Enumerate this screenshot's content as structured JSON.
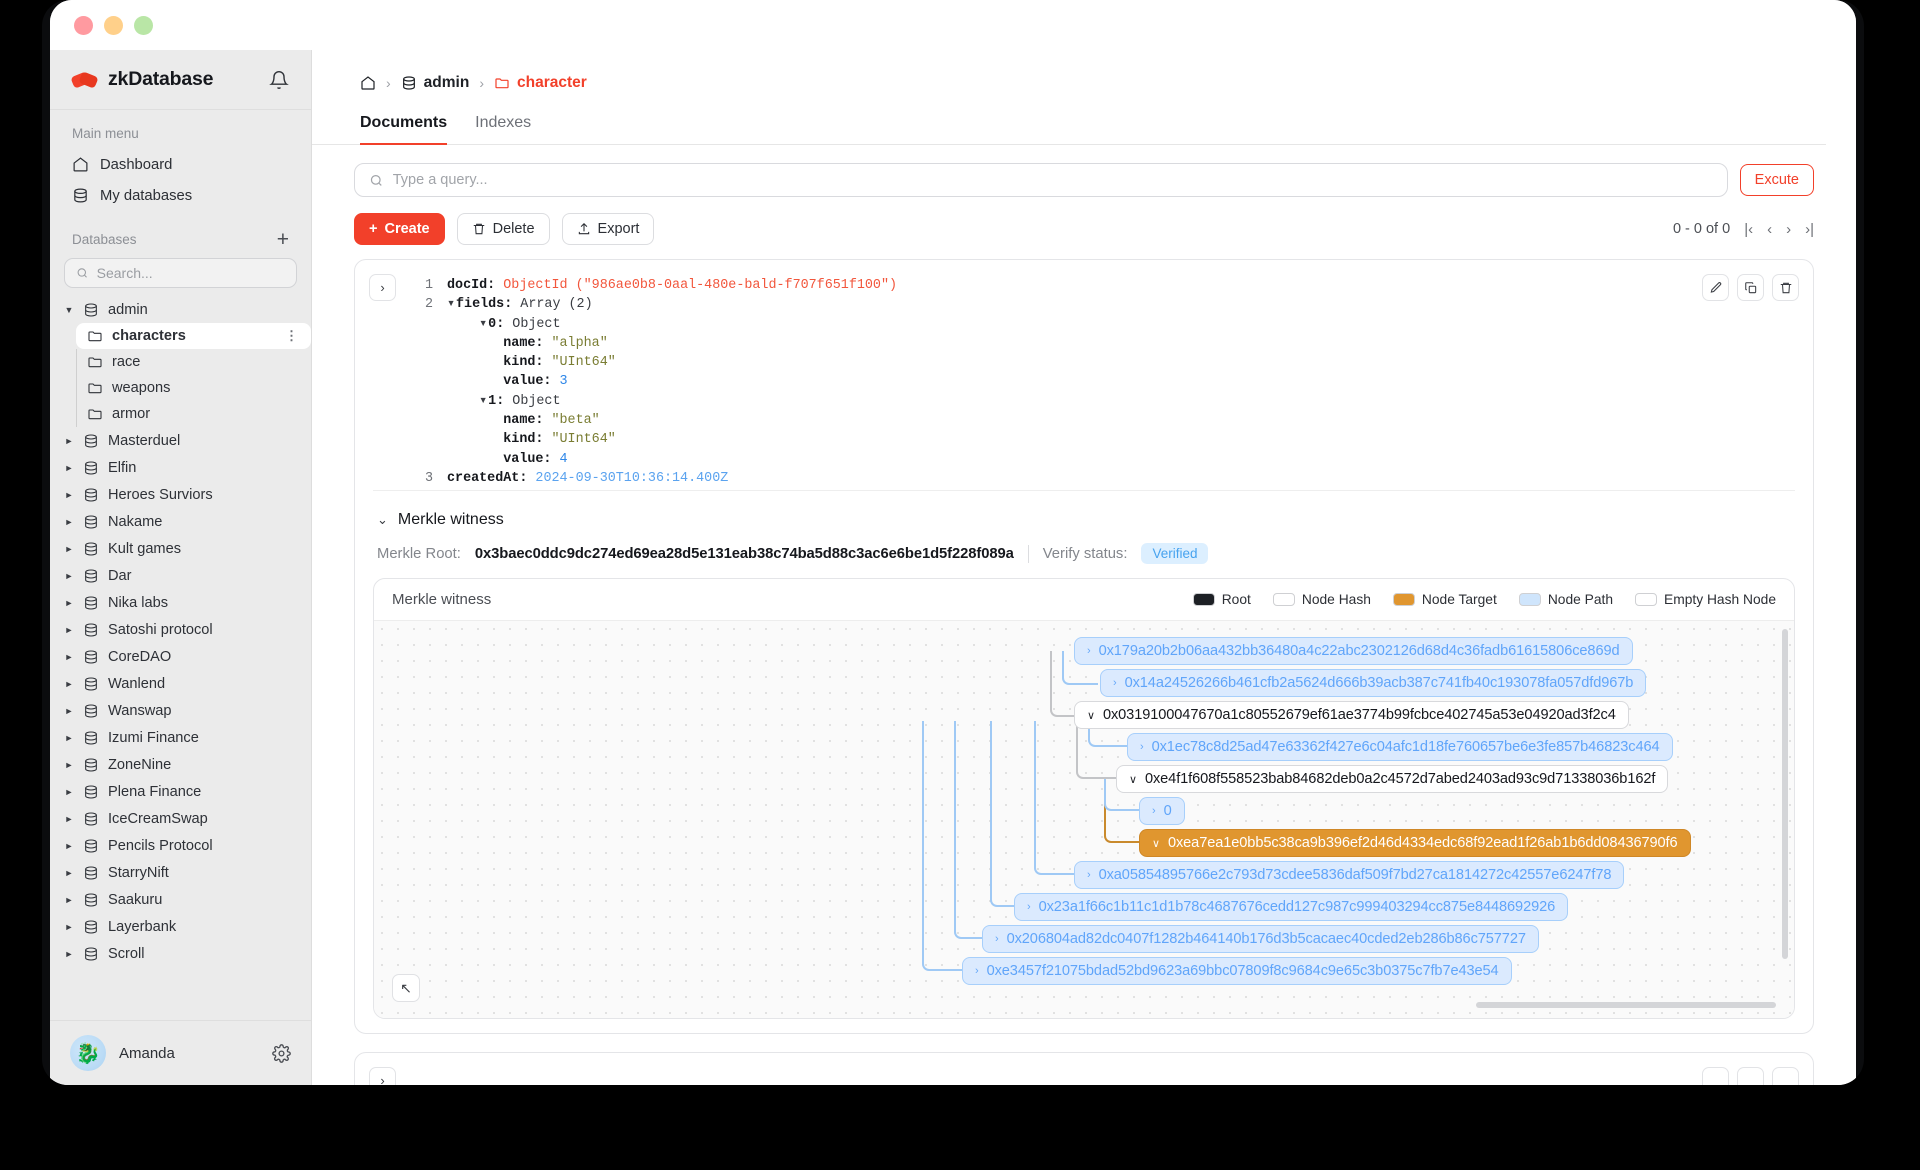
{
  "app": {
    "brand": "zkDatabase",
    "window_dots": [
      "close",
      "minimize",
      "maximize"
    ]
  },
  "sidebar": {
    "main_menu_label": "Main menu",
    "menu_items": [
      {
        "label": "Dashboard",
        "icon": "home-icon"
      },
      {
        "label": "My databases",
        "icon": "database-icon"
      }
    ],
    "databases_label": "Databases",
    "add_tooltip": "+",
    "search": {
      "placeholder": "Search...",
      "value": ""
    },
    "tree": [
      {
        "name": "admin",
        "expanded": true,
        "collections": [
          {
            "name": "characters",
            "active": true
          },
          {
            "name": "race",
            "active": false
          },
          {
            "name": "weapons",
            "active": false
          },
          {
            "name": "armor",
            "active": false
          }
        ]
      },
      {
        "name": "Masterduel",
        "expanded": false,
        "collections": []
      },
      {
        "name": "Elfin",
        "expanded": false,
        "collections": []
      },
      {
        "name": "Heroes Surviors",
        "expanded": false,
        "collections": []
      },
      {
        "name": "Nakame",
        "expanded": false,
        "collections": []
      },
      {
        "name": "Kult games",
        "expanded": false,
        "collections": []
      },
      {
        "name": "Dar",
        "expanded": false,
        "collections": []
      },
      {
        "name": "Nika labs",
        "expanded": false,
        "collections": []
      },
      {
        "name": "Satoshi protocol",
        "expanded": false,
        "collections": []
      },
      {
        "name": "CoreDAO",
        "expanded": false,
        "collections": []
      },
      {
        "name": "Wanlend",
        "expanded": false,
        "collections": []
      },
      {
        "name": "Wanswap",
        "expanded": false,
        "collections": []
      },
      {
        "name": "Izumi Finance",
        "expanded": false,
        "collections": []
      },
      {
        "name": "ZoneNine",
        "expanded": false,
        "collections": []
      },
      {
        "name": "Plena Finance",
        "expanded": false,
        "collections": []
      },
      {
        "name": "IceCreamSwap",
        "expanded": false,
        "collections": []
      },
      {
        "name": "Pencils Protocol",
        "expanded": false,
        "collections": []
      },
      {
        "name": "StarryNift",
        "expanded": false,
        "collections": []
      },
      {
        "name": "Saakuru",
        "expanded": false,
        "collections": []
      },
      {
        "name": "Layerbank",
        "expanded": false,
        "collections": []
      },
      {
        "name": "Scroll",
        "expanded": false,
        "collections": []
      }
    ],
    "user": {
      "name": "Amanda",
      "avatar_emoji": "🐉"
    }
  },
  "breadcrumb": {
    "home_icon": "home-icon",
    "database": "admin",
    "collection": "character"
  },
  "tabs": [
    {
      "label": "Documents",
      "active": true
    },
    {
      "label": "Indexes",
      "active": false
    }
  ],
  "query": {
    "placeholder": "Type a query...",
    "value": "",
    "execute_label": "Excute"
  },
  "actions": {
    "create_label": "Create",
    "delete_label": "Delete",
    "export_label": "Export",
    "pager_text": "0 - 0 of 0"
  },
  "document": {
    "lines": [
      {
        "num": "1",
        "content": "docId"
      },
      {
        "num": "2",
        "content": "fields"
      },
      {
        "num": "3",
        "content": "createdAt"
      }
    ],
    "doc_id_key": "docId:",
    "doc_id_type": "ObjectId",
    "doc_id_value": "(\"986ae0b8-0aal-480e-bald-f707f651f100\")",
    "fields_key": "fields:",
    "fields_type": "Array (2)",
    "items": [
      {
        "index": "0:",
        "type": "Object",
        "name_key": "name:",
        "name_value": "\"alpha\"",
        "kind_key": "kind:",
        "kind_value": "\"UInt64\"",
        "value_key": "value:",
        "value_value": "3"
      },
      {
        "index": "1:",
        "type": "Object",
        "name_key": "name:",
        "name_value": "\"beta\"",
        "kind_key": "kind:",
        "kind_value": "\"UInt64\"",
        "value_key": "value:",
        "value_value": "4"
      }
    ],
    "created_at_key": "createdAt:",
    "created_at_value": "2024-09-30T10:36:14.400Z",
    "tools": [
      "edit-icon",
      "copy-icon",
      "delete-icon"
    ]
  },
  "merkle": {
    "section_title": "Merkle witness",
    "root_label": "Merkle Root:",
    "root_value": "0x3baec0ddc9dc274ed69ea28d5e131eab38c74ba5d88c3ac6e6be1d5f228f089a",
    "verify_label": "Verify status:",
    "verify_status": "Verified",
    "panel_title": "Merkle witness",
    "legend": [
      {
        "label": "Root",
        "color": "#1d2025"
      },
      {
        "label": "Node Hash",
        "color": "#ffffff"
      },
      {
        "label": "Node Target",
        "color": "#e0962f"
      },
      {
        "label": "Node Path",
        "color": "#cfe5fc"
      },
      {
        "label": "Empty Hash Node",
        "color": "#ffffff"
      }
    ],
    "nodes": [
      {
        "id": "n1",
        "kind": "path",
        "label": "0x179a20b2b06aa432bb36480a4c22abc2302126d68d4c36fadb61615806ce869d",
        "chev": "›"
      },
      {
        "id": "n2",
        "kind": "path",
        "label": "0x14a24526266b461cfb2a5624d666b39acb387c741fb40c193078fa057dfd967b",
        "chev": "›"
      },
      {
        "id": "n3",
        "kind": "hash",
        "label": "0x0319100047670a1c80552679ef61ae3774b99fcbce402745a53e04920ad3f2c4",
        "chev": "∨"
      },
      {
        "id": "n4",
        "kind": "path",
        "label": "0x1ec78c8d25ad47e63362f427e6c04afc1d18fe760657be6e3fe857b46823c464",
        "chev": "›"
      },
      {
        "id": "n5",
        "kind": "hash",
        "label": "0xe4f1f608f558523bab84682deb0a2c4572d7abed2403ad93c9d71338036b162f",
        "chev": "∨"
      },
      {
        "id": "n6",
        "kind": "path",
        "label": "0",
        "chev": "›"
      },
      {
        "id": "n7",
        "kind": "target",
        "label": "0xea7ea1e0bb5c38ca9b396ef2d46d4334edc68f92ead1f26ab1b6dd08436790f6",
        "chev": "∨"
      },
      {
        "id": "n8",
        "kind": "path",
        "label": "0xa05854895766e2c793d73cdee5836daf509f7bd27ca1814272c42557e6247f78",
        "chev": "›"
      },
      {
        "id": "n9",
        "kind": "path",
        "label": "0x23a1f66c1b11c1d1b78c4687676cedd127c987c999403294cc875e8448692926",
        "chev": "›"
      },
      {
        "id": "n10",
        "kind": "path",
        "label": "0x206804ad82dc0407f1282b464140b176d3b5cacaec40cded2eb286b86c757727",
        "chev": "›"
      },
      {
        "id": "n11",
        "kind": "path",
        "label": "0xe3457f21075bdad52bd9623a69bbc07809f8c9684c9e65c3b0375c7fb7e43e54",
        "chev": "›"
      }
    ],
    "zoom_control": "↖"
  },
  "colors": {
    "accent": "#f2402a",
    "node_path_bg": "#dbeafe",
    "node_path_text": "#60a5fa",
    "node_target_bg": "#e0962f",
    "verified_bg": "#dcefff",
    "verified_text": "#47a3ef"
  }
}
